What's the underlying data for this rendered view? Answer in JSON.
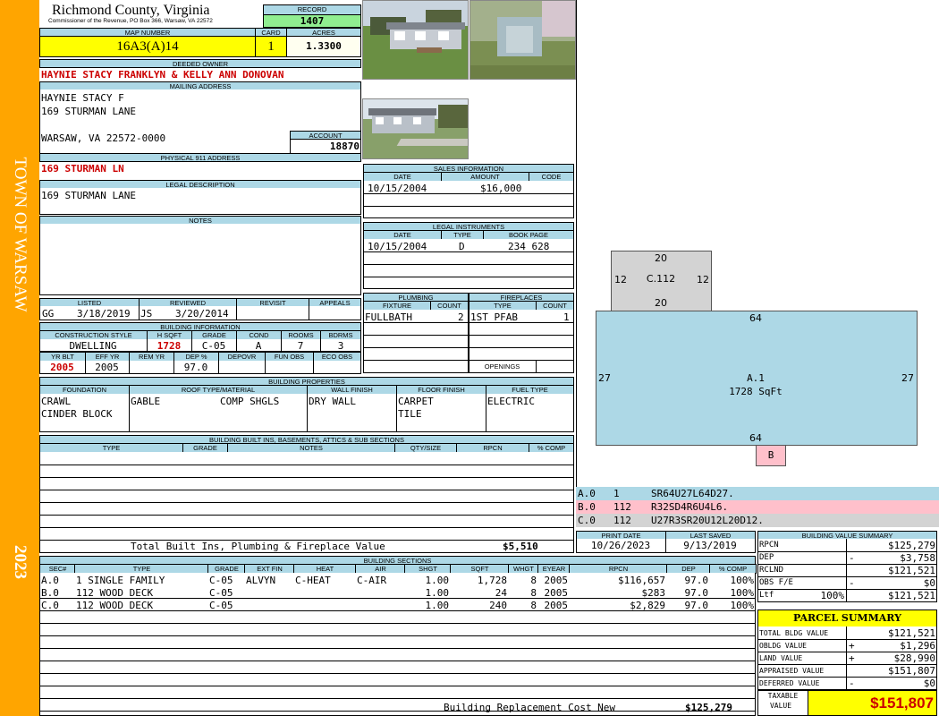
{
  "sidebar": {
    "town": "TOWN OF WARSAW",
    "year": "2023"
  },
  "header": {
    "county": "Richmond County, Virginia",
    "commissioner": "Commissioner of the Revenue, PO Box 366, Warsaw, VA 22572"
  },
  "record": {
    "label": "RECORD",
    "value": "1407"
  },
  "map_number": {
    "label": "MAP NUMBER",
    "value": "16A3(A)14"
  },
  "card": {
    "label": "CARD",
    "value": "1"
  },
  "acres": {
    "label": "ACRES",
    "value": "1.3300"
  },
  "deeded_owner": {
    "label": "DEEDED OWNER",
    "value": "HAYNIE STACY FRANKLYN & KELLY ANN DONOVAN"
  },
  "mailing": {
    "label": "MAILING ADDRESS",
    "line1": "HAYNIE STACY F",
    "line2": "169 STURMAN LANE",
    "line3": "WARSAW, VA 22572-0000"
  },
  "account": {
    "label": "ACCOUNT",
    "value": "18870"
  },
  "physical": {
    "label": "PHYSICAL 911 ADDRESS",
    "value": "169 STURMAN LN"
  },
  "legal": {
    "label": "LEGAL DESCRIPTION",
    "value": "169 STURMAN LANE"
  },
  "notes": {
    "label": "NOTES"
  },
  "status": {
    "listed_label": "LISTED",
    "reviewed_label": "REVIEWED",
    "revisit_label": "REVISIT",
    "appeals_label": "APPEALS",
    "listed_by": "GG",
    "listed_date": "3/18/2019",
    "reviewed_by": "JS",
    "reviewed_date": "3/20/2014"
  },
  "building_info": {
    "label": "BUILDING INFORMATION",
    "h1": "CONSTRUCTION STYLE",
    "h2": "H SQFT",
    "h3": "GRADE",
    "h4": "COND",
    "h5": "ROOMS",
    "h6": "BDRMS",
    "style": "DWELLING",
    "hsqft": "1728",
    "grade": "C-05",
    "cond": "A",
    "rooms": "7",
    "bdrms": "3",
    "g1": "YR BLT",
    "g2": "EFF YR",
    "g3": "REM YR",
    "g4": "DEP %",
    "g5": "DEPOVR",
    "g6": "FUN OBS",
    "g7": "ECO OBS",
    "yrblt": "2005",
    "effyr": "2005",
    "dep": "97.0"
  },
  "properties": {
    "label": "BUILDING PROPERTIES",
    "h_found": "FOUNDATION",
    "h_roof": "ROOF TYPE/MATERIAL",
    "h_wall": "WALL FINISH",
    "h_floor": "FLOOR FINISH",
    "h_fuel": "FUEL TYPE",
    "found1": "CRAWL",
    "found2": "CINDER BLOCK",
    "roof_type": "GABLE",
    "roof_mat": "COMP SHGLS",
    "wall": "DRY WALL",
    "floor1": "CARPET",
    "floor2": "TILE",
    "fuel": "ELECTRIC"
  },
  "builtins": {
    "label": "BUILDING BUILT INS, BASEMENTS, ATTICS & SUB SECTIONS",
    "h_type": "TYPE",
    "h_grade": "GRADE",
    "h_notes": "NOTES",
    "h_qty": "QTY/SIZE",
    "h_rpcn": "RPCN",
    "h_comp": "% COMP",
    "total_label": "Total Built Ins, Plumbing & Fireplace Value",
    "total_value": "$5,510"
  },
  "sales": {
    "label": "SALES INFORMATION",
    "h_date": "DATE",
    "h_amount": "AMOUNT",
    "h_code": "CODE",
    "date": "10/15/2004",
    "amount": "$16,000"
  },
  "instruments": {
    "label": "LEGAL INSTRUMENTS",
    "h_date": "DATE",
    "h_type": "TYPE",
    "h_book": "BOOK PAGE",
    "date": "10/15/2004",
    "type": "D",
    "book": "234 628"
  },
  "plumbing": {
    "label": "PLUMBING",
    "h_fixture": "FIXTURE",
    "h_count": "COUNT",
    "fixture": "FULLBATH",
    "count": "2"
  },
  "fireplaces": {
    "label": "FIREPLACES",
    "h_type": "TYPE",
    "h_count": "COUNT",
    "type": "1ST PFAB",
    "count": "1",
    "openings": "OPENINGS"
  },
  "sketch": {
    "c_label": "C.112",
    "c_top": "20",
    "c_bottom": "20",
    "c_left": "12",
    "c_right": "12",
    "a_label": "A.1",
    "a_area": "1728 SqFt",
    "a_top": "64",
    "a_bottom": "64",
    "a_left": "27",
    "a_right": "27",
    "b_label": "B",
    "legend": [
      {
        "code": "A.0",
        "num": "1",
        "desc": "SR64U27L64D27.",
        "color": "#add8e6"
      },
      {
        "code": "B.0",
        "num": "112",
        "desc": "R32SD4R6U4L6.",
        "color": "#ffc0cb"
      },
      {
        "code": "C.0",
        "num": "112",
        "desc": "U27R3SR20U12L20D12.",
        "color": "#d3d3d3"
      }
    ]
  },
  "dates": {
    "print_label": "PRINT DATE",
    "print_value": "10/26/2023",
    "saved_label": "LAST SAVED",
    "saved_value": "9/13/2019"
  },
  "sections": {
    "label": "BUILDING SECTIONS",
    "headers": [
      "SEC#",
      "TYPE",
      "GRADE",
      "EXT FIN",
      "HEAT",
      "AIR",
      "SHGT",
      "SQFT",
      "WHGT",
      "EYEAR",
      "RPCN",
      "DEP",
      "% COMP"
    ],
    "rows": [
      [
        "A.0",
        "1 SINGLE FAMILY",
        "C-05",
        "ALVYN",
        "C-HEAT",
        "C-AIR",
        "1.00",
        "1,728",
        "8",
        "2005",
        "$116,657",
        "97.0",
        "100%"
      ],
      [
        "B.0",
        "112 WOOD DECK",
        "C-05",
        "",
        "",
        "",
        "1.00",
        "24",
        "8",
        "2005",
        "$283",
        "97.0",
        "100%"
      ],
      [
        "C.0",
        "112 WOOD DECK",
        "C-05",
        "",
        "",
        "",
        "1.00",
        "240",
        "8",
        "2005",
        "$2,829",
        "97.0",
        "100%"
      ]
    ],
    "replacement_label": "Building Replacement Cost New",
    "replacement_value": "$125,279"
  },
  "bvs": {
    "label": "BUILDING VALUE SUMMARY",
    "rpcn_label": "RPCN",
    "rpcn": "$125,279",
    "dep_label": "DEP",
    "dep_sign": "-",
    "dep": "$3,758",
    "rclnd_label": "RCLND",
    "rclnd": "$121,521",
    "obs_label": "OBS F/E",
    "obs_sign": "-",
    "obs": "$0",
    "ltf_label": "Ltf",
    "ltf_pct": "100%",
    "ltf": "$121,521"
  },
  "parcel": {
    "label": "PARCEL SUMMARY",
    "tbv_label": "TOTAL BLDG VALUE",
    "tbv": "$121,521",
    "obldg_label": "OBLDG VALUE",
    "obldg_sign": "+",
    "obldg": "$1,296",
    "land_label": "LAND VALUE",
    "land_sign": "+",
    "land": "$28,990",
    "appraised_label": "APPRAISED VALUE",
    "appraised": "$151,807",
    "deferred_label": "DEFERRED VALUE",
    "deferred_sign": "-",
    "deferred": "$0",
    "taxable_label1": "TAXABLE",
    "taxable_label2": "VALUE",
    "taxable": "$151,807"
  },
  "colors": {
    "sidebar": "#ffa500",
    "header": "#add8e6",
    "yellow": "#ffff00",
    "green": "#90ee90",
    "red": "#cc0000"
  }
}
